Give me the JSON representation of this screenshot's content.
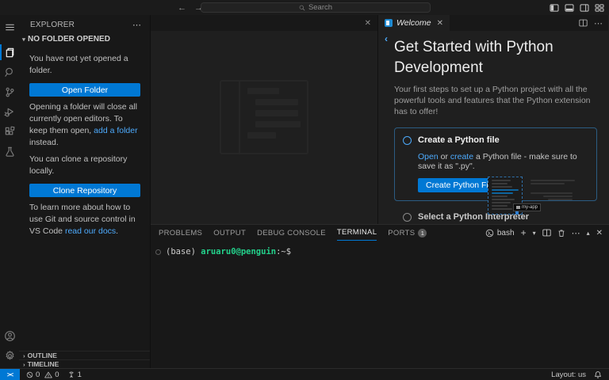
{
  "titlebar": {
    "search_placeholder": "Search"
  },
  "sidebar": {
    "title": "EXPLORER",
    "section_label": "NO FOLDER OPENED",
    "para_no_folder": "You have not yet opened a folder.",
    "open_folder_button": "Open Folder",
    "para_open_pre": "Opening a folder will close all currently open editors. To keep them open, ",
    "para_open_link": "add a folder",
    "para_open_post": " instead.",
    "para_clone": "You can clone a repository locally.",
    "clone_button": "Clone Repository",
    "para_docs_pre": "To learn more about how to use Git and source control in VS Code ",
    "para_docs_link": "read our docs",
    "para_docs_post": ".",
    "outline_label": "OUTLINE",
    "timeline_label": "TIMELINE"
  },
  "editor": {
    "welcome_tab_label": "Welcome",
    "walkthrough": {
      "title": "Get Started with Python Development",
      "description": "Your first steps to set up a Python project with all the powerful tools and features that the Python extension has to offer!",
      "step1": {
        "title": "Create a Python file",
        "body_link_open": "Open",
        "body_mid": " or ",
        "body_link_create": "create",
        "body_rest": " a Python file - make sure to save it as \".py\".",
        "button_label": "Create Python File"
      },
      "step2": {
        "title": "Select a Python Interpreter"
      },
      "thumbnail_tooltip": "my-app"
    }
  },
  "panel": {
    "tabs": [
      "PROBLEMS",
      "OUTPUT",
      "DEBUG CONSOLE",
      "TERMINAL",
      "PORTS"
    ],
    "ports_badge": "1",
    "shell_label": "bash",
    "terminal": {
      "prompt_prefix": "(base) ",
      "prompt_userhost": "aruaru0@penguin",
      "prompt_suffix": ":~$"
    }
  },
  "statusbar": {
    "errors": "0",
    "warnings": "0",
    "ports_count": "1",
    "layout_label": "Layout: us"
  },
  "colors": {
    "accent": "#0078d4",
    "link": "#4daafc",
    "terminal_green": "#23d18b"
  }
}
